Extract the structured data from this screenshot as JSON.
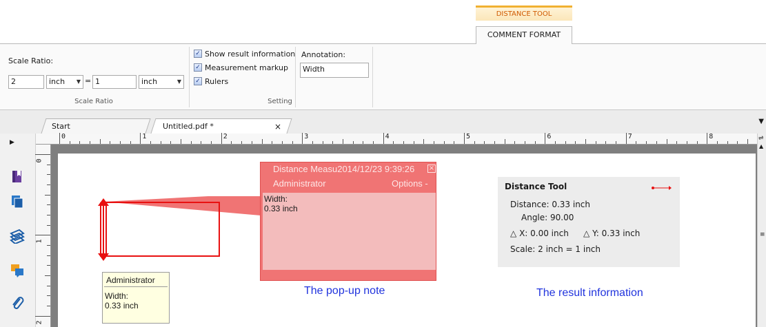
{
  "ribbon": {
    "context_tab_label": "DISTANCE TOOL",
    "active_tab_label": "COMMENT FORMAT",
    "scale_ratio": {
      "title": "Scale Ratio:",
      "left_value": "2",
      "left_unit": "inch",
      "equals": "=",
      "right_value": "1",
      "right_unit": "inch",
      "group_label": "Scale Ratio"
    },
    "setting": {
      "show_result": "Show result information",
      "measurement_markup": "Measurement markup",
      "rulers": "Rulers",
      "group_label": "Setting"
    },
    "annotation": {
      "label": "Annotation:",
      "value": "Width"
    }
  },
  "doc_tabs": {
    "start": "Start",
    "file": "Untitled.pdf *",
    "close": "×"
  },
  "ruler": {
    "h_labels": [
      "0",
      "1",
      "2",
      "3",
      "4",
      "5",
      "6",
      "7",
      "8"
    ],
    "v_labels": [
      "0",
      "1",
      "2"
    ]
  },
  "popup": {
    "title": "Distance Measu2014/12/23 9:39:26",
    "author": "Administrator",
    "options": "Options -",
    "line1": "Width:",
    "line2": "0.33 inch",
    "caption": "The pop-up note"
  },
  "tooltip": {
    "author": "Administrator",
    "line1": "Width:",
    "line2": "0.33 inch"
  },
  "result": {
    "title": "Distance Tool",
    "distance": "Distance:  0.33 inch",
    "angle": "Angle:  90.00",
    "dx": "X: 0.00 inch",
    "dy": "Y: 0.33 inch",
    "delta": "△",
    "scale": "Scale:  2 inch = 1 inch",
    "caption": "The result information"
  },
  "colors": {
    "accent_orange": "#d05a00",
    "markup_red": "#e81010",
    "popup_red": "#f07474",
    "caption_blue": "#2033dd"
  }
}
